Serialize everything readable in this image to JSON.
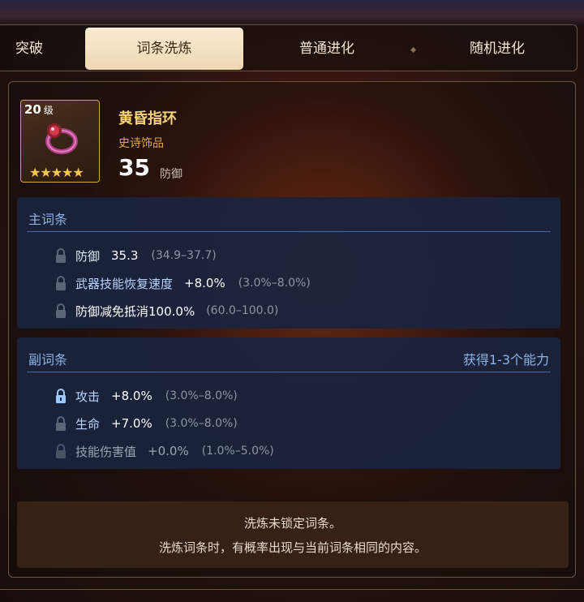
{
  "tabs": [
    {
      "label": "突破",
      "active": false
    },
    {
      "label": "词条洗炼",
      "active": true
    },
    {
      "label": "普通进化",
      "active": false
    },
    {
      "label": "随机进化",
      "active": false
    }
  ],
  "item": {
    "level": "20",
    "level_unit": "级",
    "name": "黄昏指环",
    "rarity": "史诗饰品",
    "stat_value": "35",
    "stat_label": "防御",
    "stars": "★★★★★",
    "star_count": 5,
    "icon": "ring-icon"
  },
  "main_affixes": {
    "title": "主词条",
    "rows": [
      {
        "name": "防御",
        "value": "35.3",
        "range": "(34.9–37.7)",
        "locked": false
      },
      {
        "name": "武器技能恢复速度",
        "value": "+8.0%",
        "range": "(3.0%–8.0%)",
        "locked": false
      },
      {
        "name": "防御减免抵消100.0%",
        "value": "",
        "range": "(60.0–100.0)",
        "locked": false
      }
    ]
  },
  "sub_affixes": {
    "title": "副词条",
    "right_label": "获得1-3个能力",
    "rows": [
      {
        "name": "攻击",
        "value": "+8.0%",
        "range": "(3.0%–8.0%)",
        "locked": true
      },
      {
        "name": "生命",
        "value": "+7.0%",
        "range": "(3.0%–8.0%)",
        "locked": false
      },
      {
        "name": "技能伤害值",
        "value": "+0.0%",
        "range": "(1.0%–5.0%)",
        "locked": false
      }
    ]
  },
  "notice": {
    "line1": "洗炼未锁定词条。",
    "line2": "洗炼词条时，有概率出现与当前词条相同的内容。"
  },
  "colors": {
    "accent_gold": "#f7d27a",
    "panel_blue": "#1a243e",
    "title_blue": "#8fb3e6",
    "tab_active": "#f2dcb7"
  }
}
